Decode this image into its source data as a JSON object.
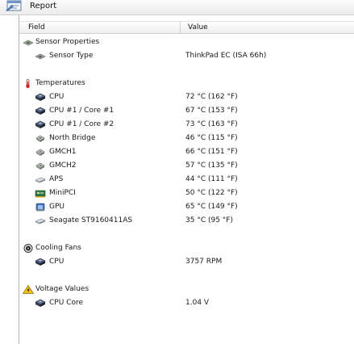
{
  "toolbar": {
    "report_label": "Report"
  },
  "columns": {
    "field": "Field",
    "value": "Value"
  },
  "groups": [
    {
      "title": "Sensor Properties",
      "icon": "sensor-properties-icon",
      "items": [
        {
          "label": "Sensor Type",
          "value": "ThinkPad EC  (ISA 66h)",
          "icon": "sensor-icon"
        }
      ]
    },
    {
      "title": "Temperatures",
      "icon": "thermometer-icon",
      "items": [
        {
          "label": "CPU",
          "value": "72 °C  (162 °F)",
          "icon": "cpu-icon"
        },
        {
          "label": "CPU #1 / Core #1",
          "value": "67 °C  (153 °F)",
          "icon": "cpu-icon"
        },
        {
          "label": "CPU #1 / Core #2",
          "value": "73 °C  (163 °F)",
          "icon": "cpu-icon"
        },
        {
          "label": "North Bridge",
          "value": "46 °C  (115 °F)",
          "icon": "chip-icon"
        },
        {
          "label": "GMCH1",
          "value": "66 °C  (151 °F)",
          "icon": "chip-icon"
        },
        {
          "label": "GMCH2",
          "value": "57 °C  (135 °F)",
          "icon": "chip-icon"
        },
        {
          "label": "APS",
          "value": "44 °C  (111 °F)",
          "icon": "hard-disk-icon"
        },
        {
          "label": "MiniPCI",
          "value": "50 °C  (122 °F)",
          "icon": "pci-card-icon"
        },
        {
          "label": "GPU",
          "value": "65 °C  (149 °F)",
          "icon": "gpu-icon"
        },
        {
          "label": "Seagate ST9160411AS",
          "value": "35 °C  (95 °F)",
          "icon": "hard-disk-icon"
        }
      ]
    },
    {
      "title": "Cooling Fans",
      "icon": "fan-icon",
      "items": [
        {
          "label": "CPU",
          "value": "3757 RPM",
          "icon": "cpu-icon"
        }
      ]
    },
    {
      "title": "Voltage Values",
      "icon": "voltage-warning-icon",
      "items": [
        {
          "label": "CPU Core",
          "value": "1.04 V",
          "icon": "cpu-icon"
        }
      ]
    }
  ]
}
